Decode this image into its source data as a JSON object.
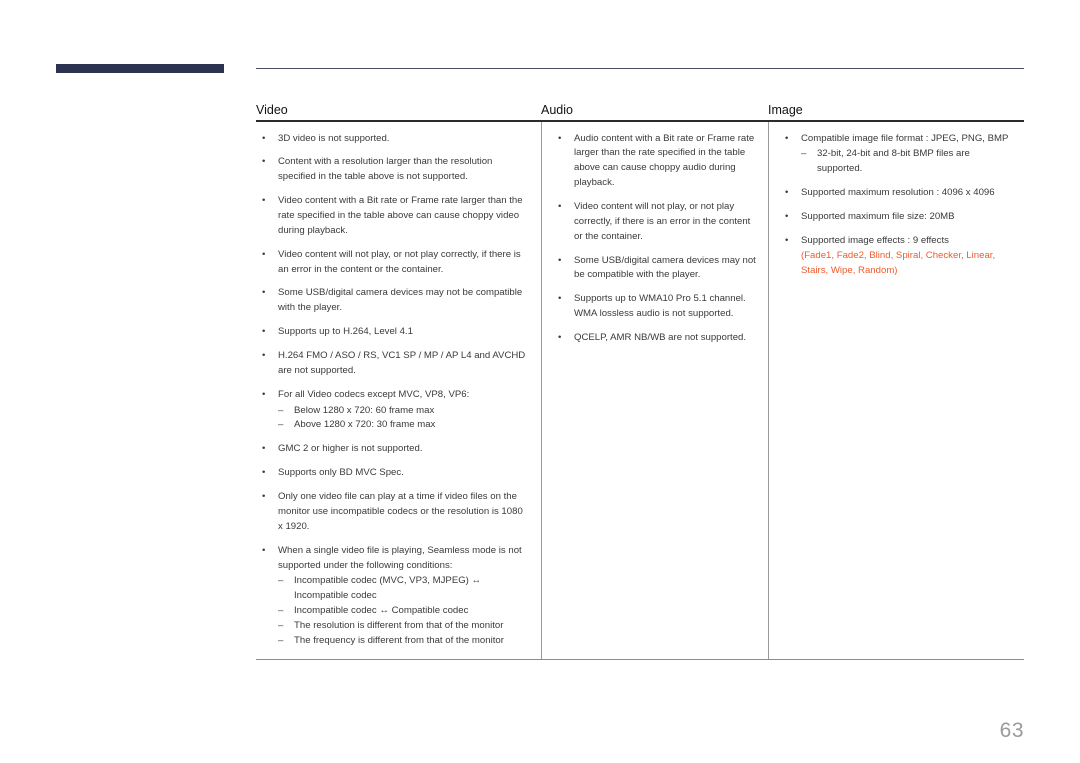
{
  "page": {
    "number": "63",
    "accent_bar_color": "#2b3350",
    "rule_color": "#4a4e66",
    "effect_text_color": "#ef5b2b"
  },
  "table": {
    "columns": [
      {
        "header": "Video",
        "items": [
          {
            "text": "3D video is not supported.",
            "sub": []
          },
          {
            "text": "Content with a resolution larger than the resolution specified in the table above is not supported.",
            "sub": []
          },
          {
            "text": "Video content with a Bit rate or Frame rate larger than the rate specified in the table above can cause choppy video during playback.",
            "sub": []
          },
          {
            "text": "Video content will not play, or not play correctly, if there is an error in the content or the container.",
            "sub": []
          },
          {
            "text": "Some USB/digital camera devices may not be compatible with the player.",
            "sub": []
          },
          {
            "text": "Supports up to H.264, Level 4.1",
            "sub": []
          },
          {
            "text": "H.264 FMO / ASO / RS, VC1 SP / MP / AP L4 and AVCHD are not supported.",
            "sub": []
          },
          {
            "text": "For all Video codecs except MVC, VP8, VP6:",
            "sub": [
              "Below 1280 x 720: 60 frame max",
              "Above 1280 x 720: 30 frame max"
            ]
          },
          {
            "text": "GMC 2 or higher is not supported.",
            "sub": []
          },
          {
            "text": "Supports only BD MVC Spec.",
            "sub": []
          },
          {
            "text": "Only one video file can play at a time if video files on the monitor use incompatible codecs or the resolution is 1080 x 1920.",
            "sub": []
          },
          {
            "text": "When a single video file is playing, Seamless mode is not supported under the following conditions:",
            "sub": [
              "Incompatible codec (MVC, VP3, MJPEG) ↔ Incompatible codec",
              "Incompatible codec ↔ Compatible codec",
              "The resolution is different from that of the monitor",
              "The frequency is different from that of the monitor"
            ]
          }
        ]
      },
      {
        "header": "Audio",
        "items": [
          {
            "text": "Audio content with a Bit rate or Frame rate larger than the rate specified in the table above can cause choppy audio during playback.",
            "sub": []
          },
          {
            "text": "Video content will not play, or not play correctly, if there is an error in the content or the container.",
            "sub": []
          },
          {
            "text": "Some USB/digital camera devices may not be compatible with the player.",
            "sub": []
          },
          {
            "text": "Supports up to WMA10 Pro 5.1 channel. WMA lossless audio is not supported.",
            "sub": []
          },
          {
            "text": "QCELP, AMR NB/WB are not supported.",
            "sub": []
          }
        ]
      },
      {
        "header": "Image",
        "items": [
          {
            "text": "Compatible image file format : JPEG, PNG, BMP",
            "sub": [
              "32-bit, 24-bit and 8-bit BMP files are supported."
            ]
          },
          {
            "text": "Supported maximum resolution : 4096 x 4096",
            "sub": []
          },
          {
            "text": "Supported maximum file size: 20MB",
            "sub": []
          },
          {
            "text": "Supported image effects : 9 effects",
            "sub": [],
            "effects_line": "(Fade1, Fade2, Blind, Spiral, Checker, Linear, Stairs, Wipe, Random)"
          }
        ]
      }
    ]
  }
}
